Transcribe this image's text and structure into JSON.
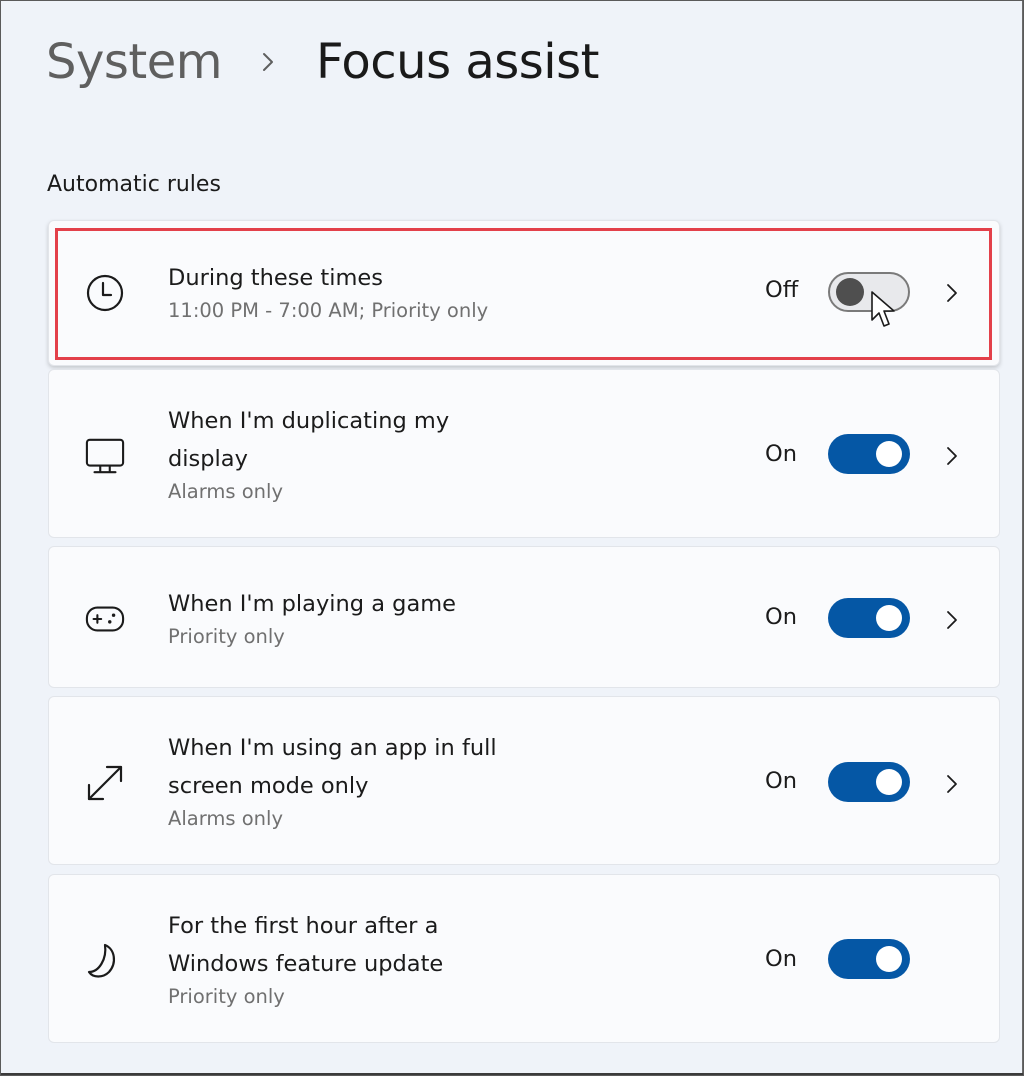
{
  "breadcrumb": {
    "parent": "System",
    "separator_icon": "chevron-right-icon",
    "current": "Focus assist"
  },
  "section": {
    "title": "Automatic rules"
  },
  "colors": {
    "accent": "#0557a5",
    "background": "#eff3f9",
    "card": "#fafbfd",
    "highlight": "#e3404a"
  },
  "rules": [
    {
      "icon": "clock-icon",
      "title": "During these times",
      "subtitle": "11:00 PM - 7:00 AM; Priority only",
      "state_label": "Off",
      "enabled": false,
      "has_chevron": true,
      "highlighted": true
    },
    {
      "icon": "monitor-icon",
      "title_line1": "When I'm duplicating my",
      "title_line2": "display",
      "subtitle": "Alarms only",
      "state_label": "On",
      "enabled": true,
      "has_chevron": true
    },
    {
      "icon": "gamepad-icon",
      "title": "When I'm playing a game",
      "subtitle": "Priority only",
      "state_label": "On",
      "enabled": true,
      "has_chevron": true
    },
    {
      "icon": "fullscreen-arrows-icon",
      "title_line1": "When I'm using an app in full",
      "title_line2": "screen mode only",
      "subtitle": "Alarms only",
      "state_label": "On",
      "enabled": true,
      "has_chevron": true
    },
    {
      "icon": "moon-icon",
      "title_line1": "For the first hour after a",
      "title_line2": "Windows feature update",
      "subtitle": "Priority only",
      "state_label": "On",
      "enabled": true,
      "has_chevron": false
    }
  ]
}
